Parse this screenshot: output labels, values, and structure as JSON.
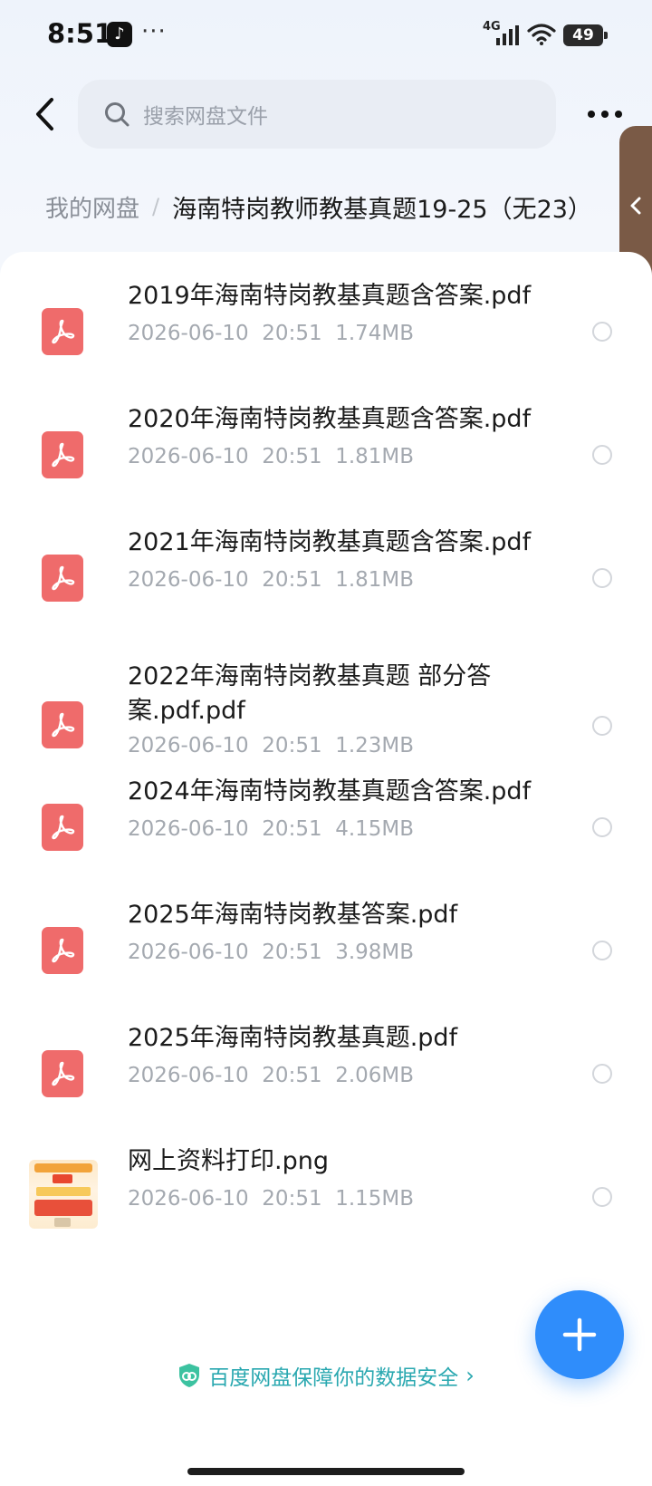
{
  "status_bar": {
    "time": "8:51",
    "network": "4G",
    "battery": "49",
    "dots": "···"
  },
  "top_bar": {
    "search_placeholder": "搜索网盘文件"
  },
  "breadcrumb": {
    "root": "我的网盘",
    "separator": "/",
    "current": "海南特岗教师教基真题19-25（无23）"
  },
  "files": [
    {
      "name": "2019年海南特岗教基真题含答案.pdf",
      "date": "2026-06-10",
      "time": "20:51",
      "size": "1.74MB",
      "type": "pdf"
    },
    {
      "name": "2020年海南特岗教基真题含答案.pdf",
      "date": "2026-06-10",
      "time": "20:51",
      "size": "1.81MB",
      "type": "pdf"
    },
    {
      "name": "2021年海南特岗教基真题含答案.pdf",
      "date": "2026-06-10",
      "time": "20:51",
      "size": "1.81MB",
      "type": "pdf"
    },
    {
      "name": "2022年海南特岗教基真题 部分答案.pdf.pdf",
      "date": "2026-06-10",
      "time": "20:51",
      "size": "1.23MB",
      "type": "pdf"
    },
    {
      "name": "2024年海南特岗教基真题含答案.pdf",
      "date": "2026-06-10",
      "time": "20:51",
      "size": "4.15MB",
      "type": "pdf"
    },
    {
      "name": "2025年海南特岗教基答案.pdf",
      "date": "2026-06-10",
      "time": "20:51",
      "size": "3.98MB",
      "type": "pdf"
    },
    {
      "name": "2025年海南特岗教基真题.pdf",
      "date": "2026-06-10",
      "time": "20:51",
      "size": "2.06MB",
      "type": "pdf"
    },
    {
      "name": "网上资料打印.png",
      "date": "2026-06-10",
      "time": "20:51",
      "size": "1.15MB",
      "type": "image"
    }
  ],
  "footer": {
    "safety_text": "百度网盘保障你的数据安全",
    "chevron": "›"
  },
  "colors": {
    "pdf_icon": "#ef6b6b",
    "fab": "#2f8dfb",
    "safety_text": "#2aa8b0",
    "side_tab": "#7a5a46"
  },
  "icons": {
    "back": "back-arrow-icon",
    "search": "search-icon",
    "more": "more-dots-icon",
    "pdf": "pdf-file-icon",
    "add": "plus-icon",
    "shield": "shield-icon"
  }
}
